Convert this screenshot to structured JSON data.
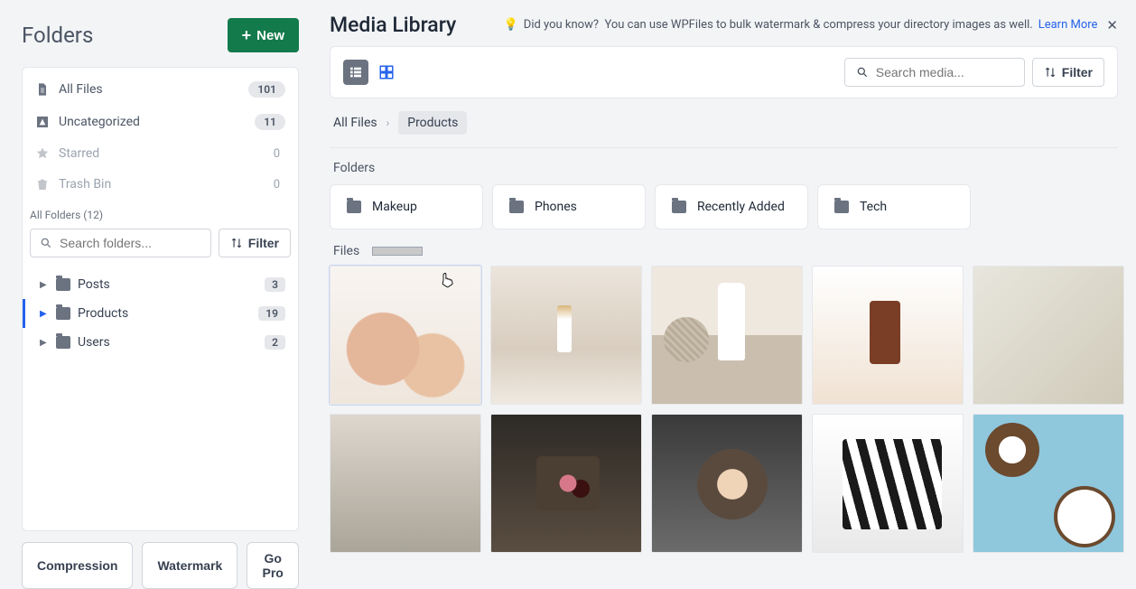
{
  "sidebar": {
    "title": "Folders",
    "new_label": "New",
    "nav": {
      "all_files": {
        "label": "All Files",
        "count": "101"
      },
      "uncategorized": {
        "label": "Uncategorized",
        "count": "11"
      },
      "starred": {
        "label": "Starred",
        "count": "0"
      },
      "trash": {
        "label": "Trash Bin",
        "count": "0"
      }
    },
    "all_folders_label": "All Folders (12)",
    "search_placeholder": "Search folders...",
    "filter_label": "Filter",
    "tree": {
      "posts": {
        "label": "Posts",
        "count": "3"
      },
      "products": {
        "label": "Products",
        "count": "19"
      },
      "users": {
        "label": "Users",
        "count": "2"
      }
    },
    "bottom": {
      "compression": "Compression",
      "watermark": "Watermark",
      "gopro": "Go Pro"
    }
  },
  "main": {
    "title": "Media Library",
    "note_prefix": "Did you know?",
    "note_text": "You can use WPFiles to bulk watermark & compress your directory images as well.",
    "learn_more": "Learn More",
    "search_placeholder": "Search media...",
    "filter_label": "Filter",
    "breadcrumb": {
      "root": "All Files",
      "current": "Products"
    },
    "folders_label": "Folders",
    "folders": [
      "Makeup",
      "Phones",
      "Recently Added",
      "Tech"
    ],
    "files_label": "Files"
  }
}
